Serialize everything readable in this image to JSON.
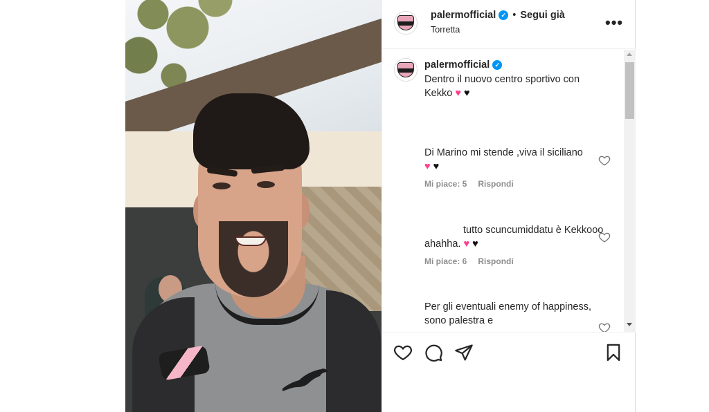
{
  "post": {
    "username": "palermofficial",
    "follow_separator": "•",
    "follow_label": "Segui già",
    "location": "Torretta",
    "more_label": "•••"
  },
  "caption": {
    "username": "palermofficial",
    "text": "Dentro il nuovo centro sportivo con Kekko"
  },
  "comments": [
    {
      "text": "Di Marino mi stende ,viva il siciliano",
      "likes": "Mi piace: 5",
      "reply": "Rispondi"
    },
    {
      "text": "tutto scuncumiddatu è Kekkooo ahahha.",
      "likes": "Mi piace: 6",
      "reply": "Rispondi"
    },
    {
      "text": "Per gli eventuali enemy of happiness, sono palestra e"
    }
  ],
  "icons": {
    "verified": "verified-badge-icon",
    "more": "more-options-icon",
    "like": "heart-icon",
    "comment": "comment-icon",
    "share": "share-icon",
    "save": "bookmark-icon"
  },
  "colors": {
    "verified": "#0095f6",
    "meta_gray": "#8e8e8e",
    "pink_heart": "#ff3d8f"
  }
}
